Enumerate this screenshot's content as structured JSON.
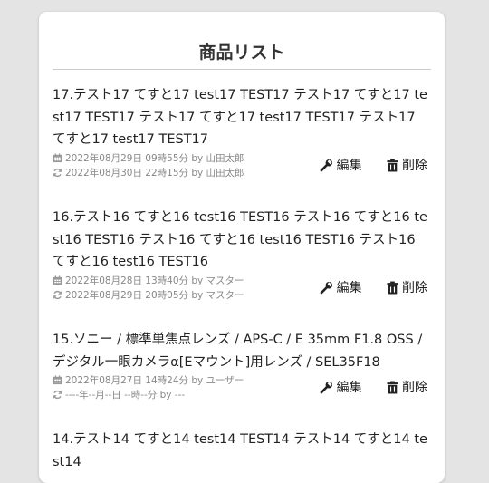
{
  "page": {
    "title": "商品リスト"
  },
  "labels": {
    "edit": "編集",
    "delete": "削除"
  },
  "items": [
    {
      "title": "17.テスト17 てすと17 test17 TEST17 テスト17 てすと17 test17 TEST17 テスト17 てすと17 test17 TEST17 テスト17 てすと17 test17 TEST17",
      "created": "2022年08月29日 09時55分 by 山田太郎",
      "updated": "2022年08月30日 22時15分 by 山田太郎"
    },
    {
      "title": "16.テスト16 てすと16 test16 TEST16 テスト16 てすと16 test16 TEST16 テスト16 てすと16 test16 TEST16 テスト16 てすと16 test16 TEST16",
      "created": "2022年08月28日 13時40分 by マスター",
      "updated": "2022年08月29日 20時05分 by マスター"
    },
    {
      "title": "15.ソニー / 標準単焦点レンズ / APS-C / E 35mm F1.8 OSS / デジタル一眼カメラα[Eマウント]用レンズ / SEL35F18",
      "created": "2022年08月27日 14時24分 by ユーザー",
      "updated": "----年--月--日 --時--分 by ---"
    },
    {
      "title": "14.テスト14 てすと14 test14 TEST14 テスト14 てすと14 test14"
    }
  ]
}
